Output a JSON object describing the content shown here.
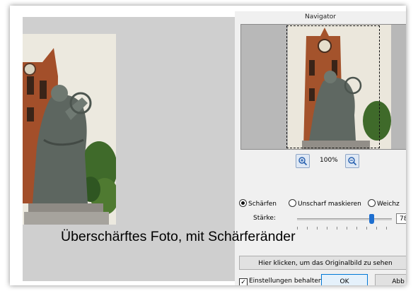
{
  "caption": "Überschärftes Foto, mit Schärferänder",
  "navigator": {
    "title": "Navigator",
    "zoom_in_icon": "zoom-in-icon",
    "zoom_out_icon": "zoom-out-icon",
    "zoom_level": "100%"
  },
  "mode": {
    "options": [
      {
        "label": "Schärfen",
        "selected": true
      },
      {
        "label": "Unscharf maskieren",
        "selected": false
      },
      {
        "label": "Weichz",
        "selected": false
      }
    ]
  },
  "strength": {
    "label": "Stärke:",
    "value": "78",
    "level": 0.78
  },
  "buttons": {
    "show_original": "Hier klicken, um das Originalbild zu sehen",
    "keep_settings": "Einstellungen behalten",
    "keep_settings_checked": true,
    "ok": "OK",
    "cancel": "Abb"
  },
  "colors": {
    "accent": "#1e6fd0",
    "preview_bg": "#cfcfcf",
    "dialog_bg": "#f0f0f0"
  }
}
